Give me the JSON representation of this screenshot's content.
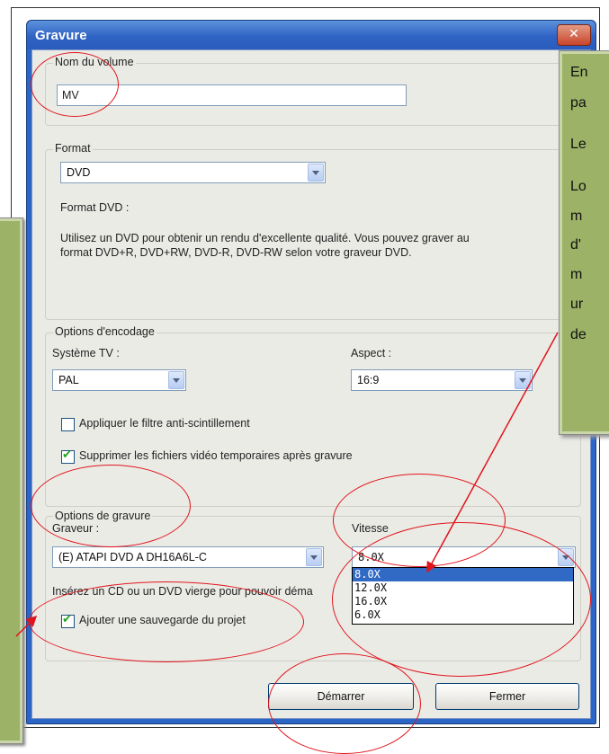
{
  "dialog": {
    "title": "Gravure",
    "close_symbol": "✕",
    "volume": {
      "group_label": "Nom du volume",
      "value": "MV"
    },
    "format": {
      "group_label": "Format",
      "selected": "DVD",
      "heading": "Format DVD :",
      "description_line1": "Utilisez un DVD pour obtenir un rendu d'excellente qualité. Vous pouvez graver au",
      "description_line2": "format DVD+R, DVD+RW, DVD-R, DVD-RW selon votre graveur DVD."
    },
    "encoding": {
      "group_label": "Options d'encodage",
      "tv_label": "Système TV :",
      "tv_value": "PAL",
      "aspect_label": "Aspect :",
      "aspect_value": "16:9",
      "flicker_label": "Appliquer le filtre anti-scintillement",
      "flicker_checked": false,
      "delete_temp_label": "Supprimer les fichiers vidéo temporaires après gravure",
      "delete_temp_checked": true
    },
    "burning": {
      "group_label": "Options de gravure",
      "burner_label": "Graveur :",
      "burner_value": "(E) ATAPI DVD A  DH16A6L-C",
      "speed_label": "Vitesse",
      "speed_value": "8.0X",
      "speed_options": [
        "8.0X",
        "12.0X",
        "16.0X",
        "6.0X"
      ],
      "speed_selected_index": 0,
      "insert_text": "Insérez un CD ou un DVD vierge pour pouvoir déma",
      "backup_label": "Ajouter une sauvegarde du projet",
      "backup_checked": true
    },
    "buttons": {
      "start": "Démarrer",
      "close": "Fermer"
    }
  },
  "callout_right": {
    "lines": [
      "En",
      "pa",
      "Le",
      "Lo",
      "m",
      "d'",
      "m",
      "ur",
      "de"
    ]
  },
  "annotation_color": "#e0141b",
  "callout_color": "#9bb267"
}
